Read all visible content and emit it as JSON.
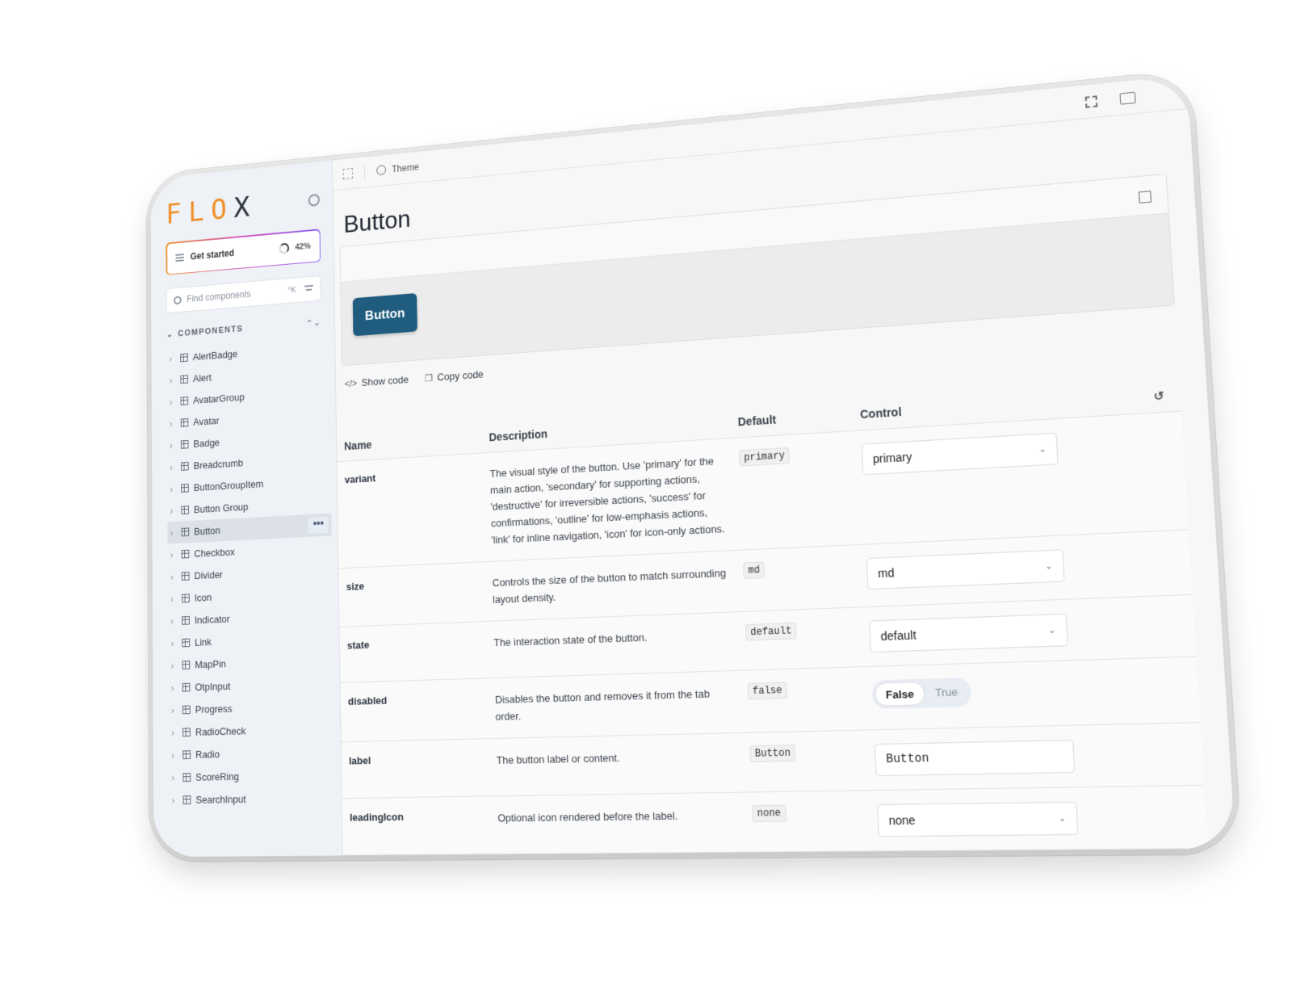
{
  "sidebar": {
    "logo": "FLO",
    "logo_x": "X",
    "get_started": {
      "label": "Get started",
      "progress": "42%"
    },
    "search": {
      "placeholder": "Find components",
      "shortcut": "^K"
    },
    "section": "COMPONENTS",
    "items": [
      "AlertBadge",
      "Alert",
      "AvatarGroup",
      "Avatar",
      "Badge",
      "Breadcrumb",
      "ButtonGroupItem",
      "Button Group",
      "Button",
      "Checkbox",
      "Divider",
      "Icon",
      "Indicator",
      "Link",
      "MapPin",
      "OtpInput",
      "Progress",
      "RadioCheck",
      "Radio",
      "ScoreRing",
      "SearchInput"
    ],
    "active_item": "Button",
    "more_label": "•••"
  },
  "topbar": {
    "theme_label": "Theme"
  },
  "page": {
    "title": "Button"
  },
  "preview": {
    "demo_button_label": "Button"
  },
  "code_actions": {
    "show_code": "Show code",
    "copy_code": "Copy code"
  },
  "table": {
    "headers": {
      "name": "Name",
      "description": "Description",
      "default": "Default",
      "control": "Control"
    },
    "rows": [
      {
        "name": "variant",
        "description": "The visual style of the button. Use 'primary' for the main action, 'secondary' for supporting actions, 'destructive' for irreversible actions, 'success' for confirmations, 'outline' for low-emphasis actions, 'link' for inline navigation, 'icon' for icon-only actions.",
        "default": "primary",
        "control_type": "select",
        "control_value": "primary"
      },
      {
        "name": "size",
        "description": "Controls the size of the button to match surrounding layout density.",
        "default": "md",
        "control_type": "select",
        "control_value": "md"
      },
      {
        "name": "state",
        "description": "The interaction state of the button.",
        "default": "default",
        "control_type": "select",
        "control_value": "default"
      },
      {
        "name": "disabled",
        "description": "Disables the button and removes it from the tab order.",
        "default": "false",
        "control_type": "toggle",
        "toggle_false": "False",
        "toggle_true": "True"
      },
      {
        "name": "label",
        "description": "The button label or content.",
        "default": "Button",
        "control_type": "text",
        "control_value": "Button"
      },
      {
        "name": "leadingIcon",
        "description": "Optional icon rendered before the label.",
        "default": "none",
        "control_type": "select",
        "control_value": "none"
      }
    ]
  },
  "colors": {
    "brand_orange": "#f0902a",
    "button_primary": "#1f5c7e"
  }
}
